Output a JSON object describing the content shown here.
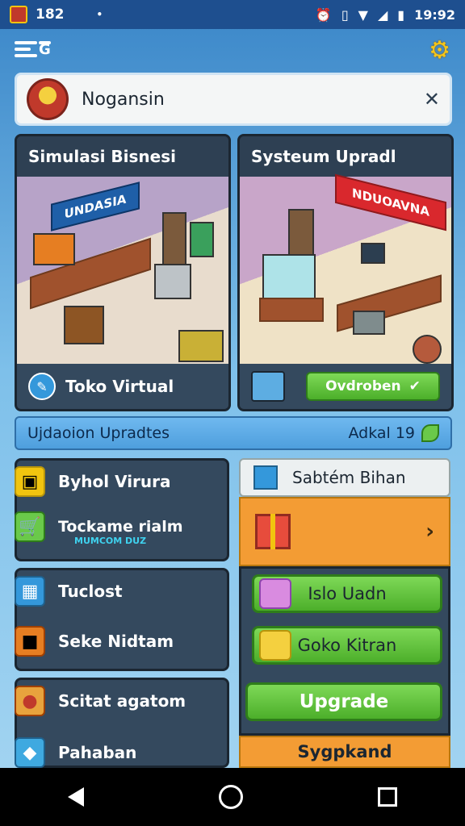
{
  "status_bar": {
    "left_text": "182",
    "dot": "•",
    "time": "19:92"
  },
  "search": {
    "label": "Nogansin"
  },
  "cards": [
    {
      "title": "Simulasi Bisnesi",
      "sign": "UNDASIA",
      "footer_label": "Toko Virtual"
    },
    {
      "title": "Systeum Upradl",
      "sign": "NDUOAVNA",
      "button_label": "Ovdroben"
    }
  ],
  "updates": {
    "label": "Ujdaoion Upradtes",
    "count_label": "Adkal 19"
  },
  "left_panels": [
    {
      "items": [
        {
          "label": "Byhol Virura",
          "icon": "box-icon"
        },
        {
          "label": "Tockame rialm",
          "sub": "MUMCOM DUZ",
          "icon": "cart-icon"
        }
      ]
    },
    {
      "items": [
        {
          "label": "Tuclost",
          "icon": "calendar-icon"
        },
        {
          "label": "Seke Nidtam",
          "icon": "crate-icon"
        }
      ]
    },
    {
      "items": [
        {
          "label": "Scitat agatom",
          "icon": "map-pin-icon"
        },
        {
          "label": "Pahaban",
          "icon": "shield-icon"
        }
      ]
    }
  ],
  "right_column": {
    "top_button": "Sabtém Bihan",
    "buttons": [
      "Islo Uadn",
      "Goko Kitran",
      "Upgrade"
    ],
    "bottom_label": "Sygpkand"
  }
}
